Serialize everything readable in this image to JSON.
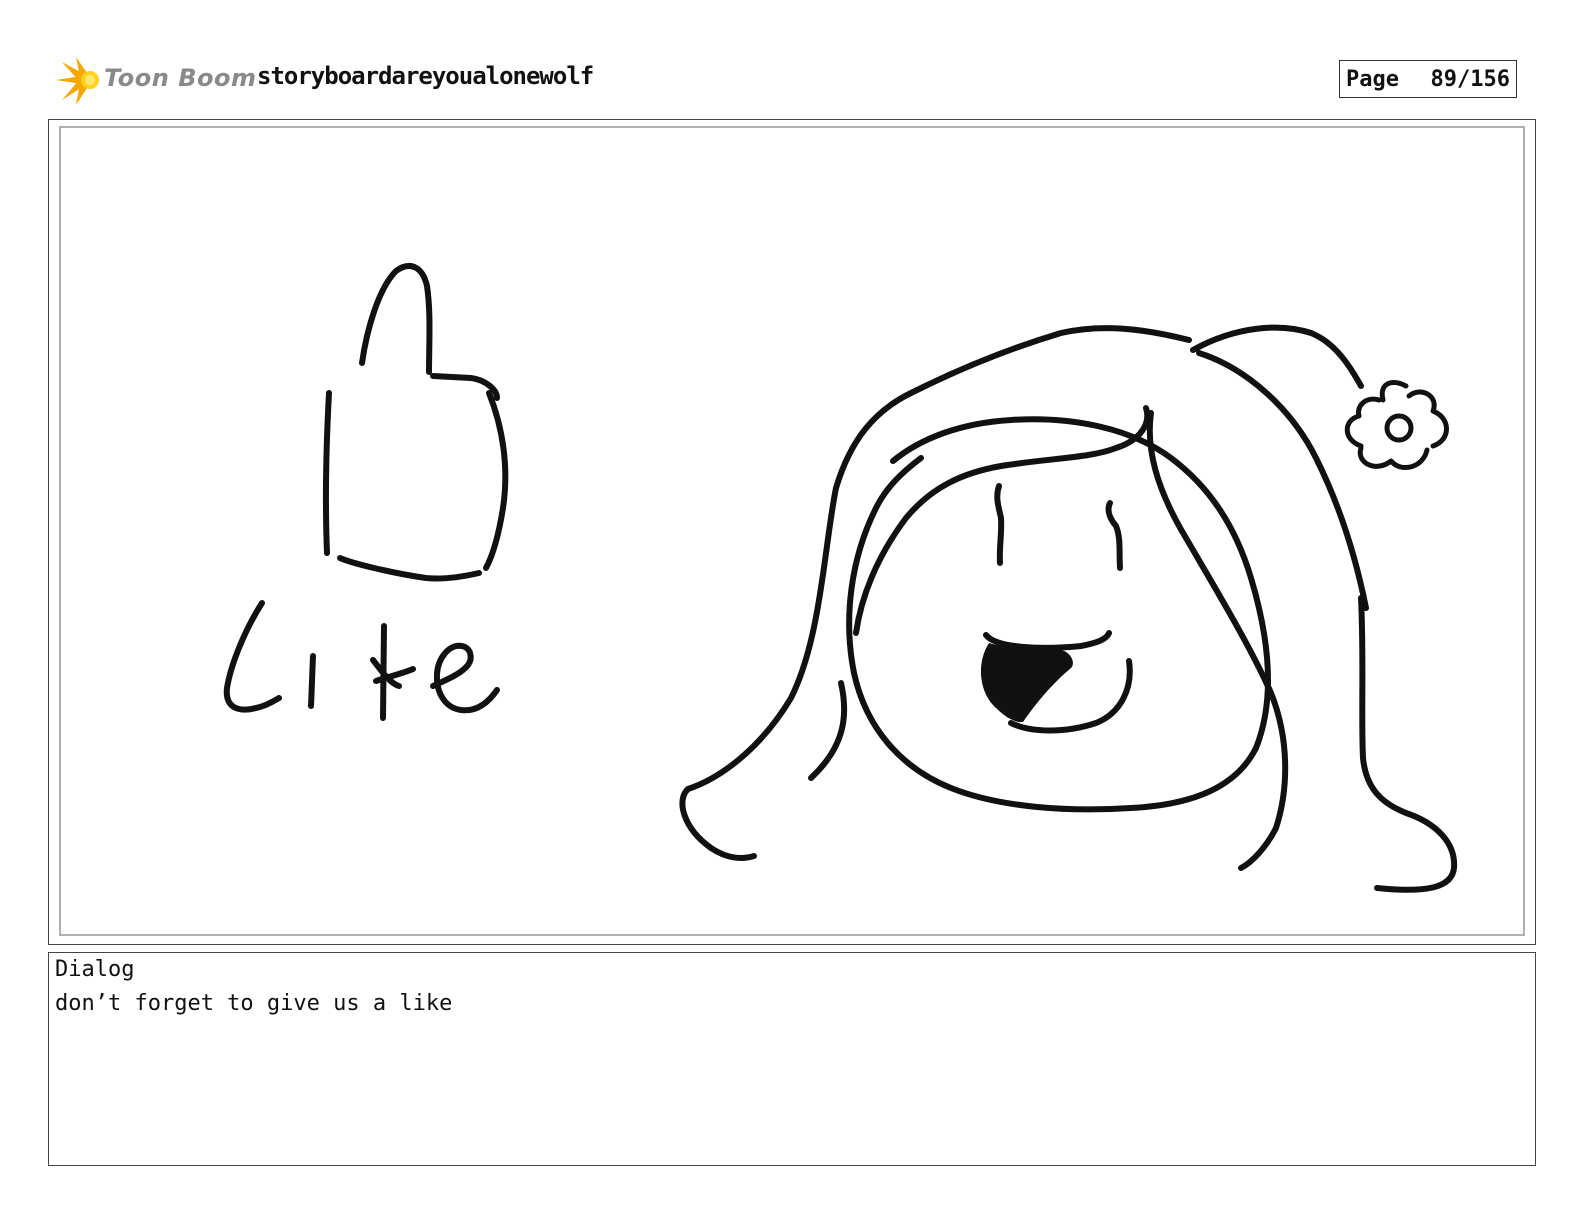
{
  "header": {
    "logo_text": "Toon Boom",
    "project_title": "storyboardareyoualonewolf",
    "page_label": "Page",
    "page_number": "89/156"
  },
  "panel": {
    "icon": "thumbs-up-icon",
    "sketch_text": "Like"
  },
  "dialog": {
    "label": "Dialog",
    "text": "don’t forget to give us a like"
  },
  "colors": {
    "logo_orange": "#f5a800",
    "logo_yellow": "#ffd21f",
    "logo_text": "#8a8a8a",
    "ink": "#111111"
  }
}
